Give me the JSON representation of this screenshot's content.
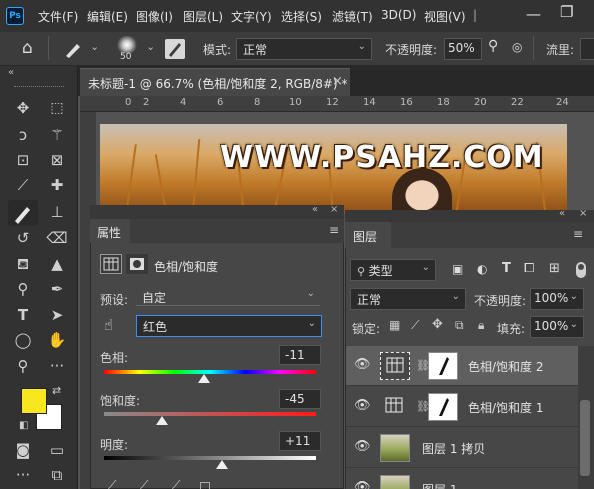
{
  "app": {
    "logo_text": "Ps"
  },
  "menu": [
    "文件(F)",
    "编辑(E)",
    "图像(I)",
    "图层(L)",
    "文字(Y)",
    "选择(S)",
    "滤镜(T)",
    "3D(D)",
    "视图(V)"
  ],
  "options_bar": {
    "brush_size": "50",
    "mode_label": "模式:",
    "mode_value": "正常",
    "opacity_label": "不透明度:",
    "opacity_value": "50%",
    "flow_label": "流里:"
  },
  "document_tab": {
    "title": "未标题-1 @ 66.7% (色相/饱和度 2, RGB/8#) *",
    "close": "×"
  },
  "ruler_ticks": [
    "0",
    "2",
    "4",
    "6",
    "8",
    "10",
    "12",
    "14",
    "16",
    "18",
    "20",
    "22",
    "24"
  ],
  "canvas": {
    "watermark": "WWW.PSAHZ.COM"
  },
  "properties_panel": {
    "tab": "属性",
    "title": "色相/饱和度",
    "preset_label": "预设:",
    "preset_value": "自定",
    "channel_value": "红色",
    "hue_label": "色相:",
    "hue_value": "-11",
    "hue_level": -11,
    "saturation_label": "饱和度:",
    "saturation_value": "-45",
    "saturation_level": -45,
    "lightness_label": "明度:",
    "lightness_value": "+11",
    "lightness_level": 11
  },
  "layers_panel": {
    "tab": "图层",
    "filter_label": "类型",
    "blend_value": "正常",
    "opacity_label": "不透明度:",
    "opacity_value": "100%",
    "lock_label": "锁定:",
    "fill_label": "填充:",
    "fill_value": "100%",
    "layers": [
      {
        "name": "色相/饱和度 2",
        "type": "adjustment",
        "selected": true
      },
      {
        "name": "色相/饱和度 1",
        "type": "adjustment",
        "selected": false
      },
      {
        "name": "图层 1 拷贝",
        "type": "image",
        "selected": false
      },
      {
        "name": "图层 1",
        "type": "image",
        "selected": false
      }
    ]
  },
  "colors": {
    "foreground": "#f8e71c",
    "background": "#ffffff",
    "accent": "#1d6fd1"
  }
}
